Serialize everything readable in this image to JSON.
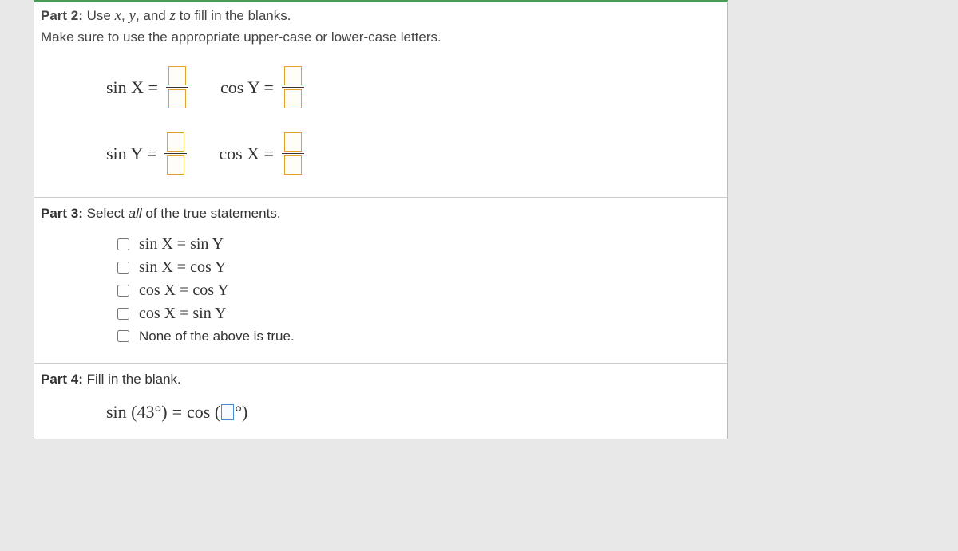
{
  "part2": {
    "title": "Part 2:",
    "instruction_pre": " Use ",
    "var1": "x",
    "comma1": ", ",
    "var2": "y",
    "instruction_mid": ", and ",
    "var3": "z",
    "instruction_post": " to fill in the blanks.",
    "subline": "Make sure to use the appropriate upper-case or lower-case letters.",
    "equations": [
      {
        "label": "sin X ="
      },
      {
        "label": "cos Y ="
      },
      {
        "label": "sin Y ="
      },
      {
        "label": "cos X ="
      }
    ]
  },
  "part3": {
    "title": "Part 3:",
    "instruction_pre": " Select ",
    "instruction_italic": "all",
    "instruction_post": " of the true statements.",
    "options": [
      {
        "expr": "sin X = sin Y",
        "type": "math"
      },
      {
        "expr": "sin X = cos Y",
        "type": "math"
      },
      {
        "expr": "cos X = cos Y",
        "type": "math"
      },
      {
        "expr": "cos X = sin Y",
        "type": "math"
      },
      {
        "expr": "None of the above is true.",
        "type": "plain"
      }
    ]
  },
  "part4": {
    "title": "Part 4:",
    "instruction": " Fill in the blank.",
    "lhs": "sin (43°)",
    "eq": " = ",
    "rhs_pre": "cos (",
    "rhs_post": "°)"
  }
}
